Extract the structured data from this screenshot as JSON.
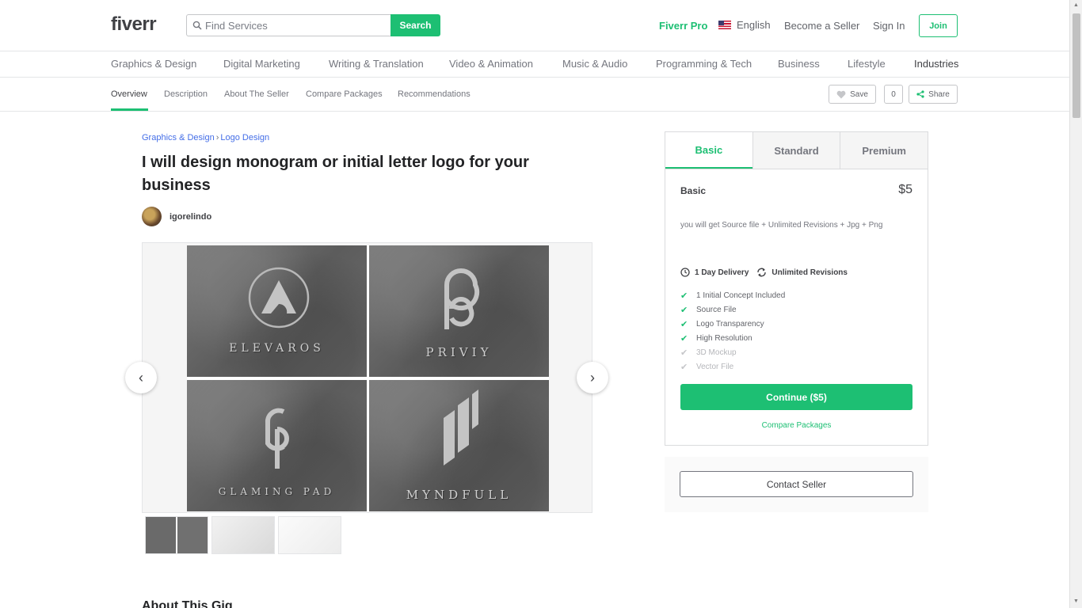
{
  "header": {
    "logo": "fiverr",
    "search_placeholder": "Find Services",
    "search_button": "Search",
    "fiverr_pro": "Fiverr Pro",
    "language": "English",
    "become_seller": "Become a Seller",
    "sign_in": "Sign In",
    "join": "Join"
  },
  "categories": [
    "Graphics & Design",
    "Digital Marketing",
    "Writing & Translation",
    "Video & Animation",
    "Music & Audio",
    "Programming & Tech",
    "Business",
    "Lifestyle",
    "Industries"
  ],
  "subnav": {
    "tabs": [
      "Overview",
      "Description",
      "About The Seller",
      "Compare Packages",
      "Recommendations"
    ],
    "save": "Save",
    "save_count": "0",
    "share": "Share"
  },
  "gig": {
    "breadcrumb": [
      "Graphics & Design",
      "Logo Design"
    ],
    "title": "I will design monogram or initial letter logo for your business",
    "seller": "igorelindo",
    "gallery_words": [
      "ELEVAROS",
      "PRIVIY",
      "GLAMING PAD",
      "MYNDFULL"
    ],
    "about_heading": "About This Gig"
  },
  "package": {
    "tabs": [
      "Basic",
      "Standard",
      "Premium"
    ],
    "name": "Basic",
    "price": "$5",
    "description": "you will get Source file + Unlimited Revisions + Jpg + Png",
    "delivery": "1 Day Delivery",
    "revisions": "Unlimited Revisions",
    "features": [
      {
        "label": "1 Initial Concept Included",
        "included": true
      },
      {
        "label": "Source File",
        "included": true
      },
      {
        "label": "Logo Transparency",
        "included": true
      },
      {
        "label": "High Resolution",
        "included": true
      },
      {
        "label": "3D Mockup",
        "included": false
      },
      {
        "label": "Vector File",
        "included": false
      }
    ],
    "continue": "Continue ($5)",
    "compare": "Compare Packages",
    "contact": "Contact Seller"
  },
  "colors": {
    "brand_green": "#1dbf73",
    "link_blue": "#446ee7"
  }
}
